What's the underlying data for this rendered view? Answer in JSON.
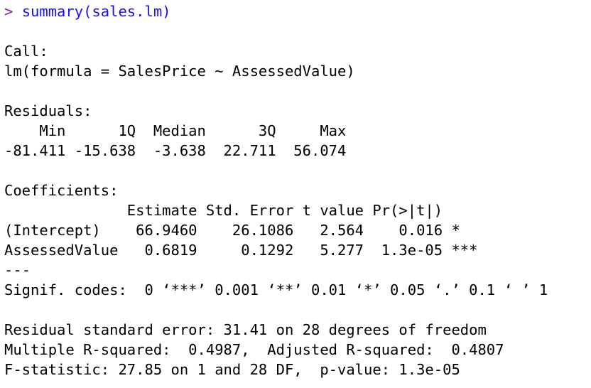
{
  "command": {
    "prompt": ">",
    "text": "summary(sales.lm)",
    "prompt_color": "#8a1fa0",
    "command_color": "#1a0dff"
  },
  "output": {
    "call_header": "Call:",
    "call": "lm(formula = SalesPrice ~ AssessedValue)",
    "residuals_header": "Residuals:",
    "residuals_columns": "    Min      1Q  Median      3Q     Max ",
    "residuals_values": "-81.411 -15.638  -3.638  22.711  56.074 ",
    "coefficients_header": "Coefficients:",
    "coefficients_columns": "              Estimate Std. Error t value Pr(>|t|)    ",
    "coefficients_rows": [
      "(Intercept)    66.9460    26.1086   2.564    0.016 *  ",
      "AssessedValue   0.6819     0.1292   5.277  1.3e-05 ***"
    ],
    "separator": "---",
    "signif_codes": "Signif. codes:  0 ‘***’ 0.001 ‘**’ 0.01 ‘*’ 0.05 ‘.’ 0.1 ‘ ’ 1",
    "residual_se": "Residual standard error: 31.41 on 28 degrees of freedom",
    "r_squared": "Multiple R-squared:  0.4987,\tAdjusted R-squared:  0.4807 ",
    "f_statistic": "F-statistic: 27.85 on 1 and 28 DF,  p-value: 1.3e-05"
  }
}
